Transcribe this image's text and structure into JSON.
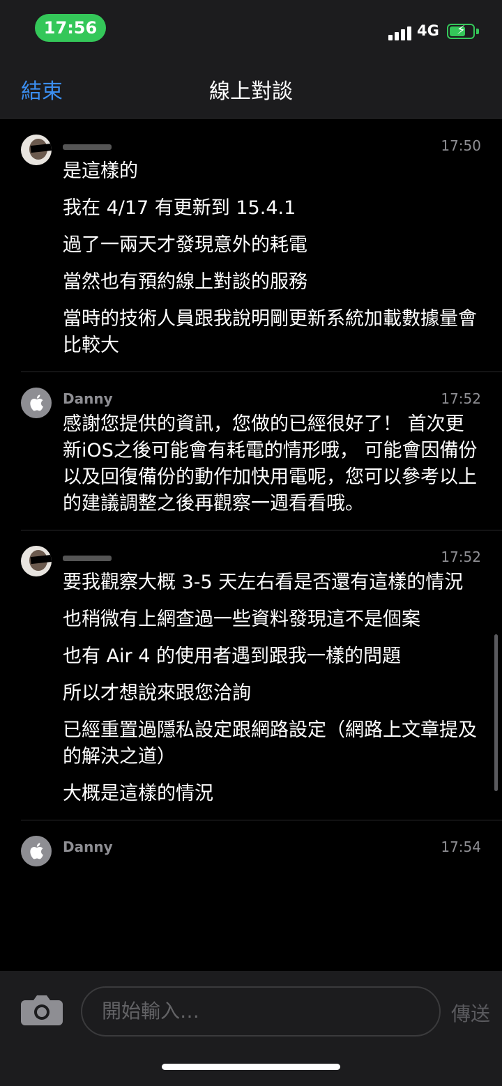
{
  "status_bar": {
    "time": "17:56",
    "network": "4G",
    "battery_icon": "battery-charging-icon"
  },
  "nav": {
    "end_label": "結束",
    "title": "線上對談"
  },
  "messages": [
    {
      "sender": "",
      "time": "17:50",
      "lines": [
        "是這樣的",
        "我在 4/17 有更新到 15.4.1",
        "過了一兩天才發現意外的耗電",
        "當然也有預約線上對談的服務",
        "當時的技術人員跟我說明剛更新系統加載數據量會比較大"
      ]
    },
    {
      "sender": "Danny",
      "time": "17:52",
      "lines": [
        "感謝您提供的資訊，您做的已經很好了！ 首次更新iOS之後可能會有耗電的情形哦， 可能會因備份以及回復備份的動作加快用電呢，您可以參考以上的建議調整之後再觀察一週看看哦。"
      ]
    },
    {
      "sender": "",
      "time": "17:52",
      "lines": [
        "要我觀察大概 3-5 天左右看是否還有這樣的情況",
        "也稍微有上網查過一些資料發現這不是個案",
        "也有 Air 4 的使用者遇到跟我一樣的問題",
        "所以才想說來跟您洽詢",
        "已經重置過隱私設定跟網路設定（網路上文章提及的解決之道）",
        "大概是這樣的情況"
      ]
    },
    {
      "sender": "Danny",
      "time": "17:54",
      "lines": []
    }
  ],
  "input": {
    "placeholder": "開始輸入…",
    "send_label": "傳送"
  },
  "colors": {
    "accent": "#3b8ef0",
    "time_pill": "#34c759",
    "background": "#000000",
    "bar": "#1c1c1e"
  }
}
